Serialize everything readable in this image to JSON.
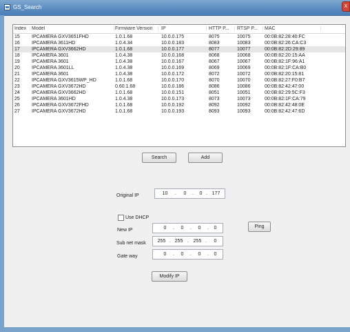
{
  "window": {
    "title": "GS_Search",
    "close_glyph": "X"
  },
  "table": {
    "columns": [
      {
        "key": "index",
        "label": "Index"
      },
      {
        "key": "model",
        "label": "Model"
      },
      {
        "key": "firmware",
        "label": "Firmware Version"
      },
      {
        "key": "ip",
        "label": "IP"
      },
      {
        "key": "http",
        "label": "HTTP P..."
      },
      {
        "key": "rtsp",
        "label": "RTSP P..."
      },
      {
        "key": "mac",
        "label": "MAC"
      }
    ],
    "selected_index": 2,
    "rows": [
      {
        "index": "15",
        "model": "IPCAMERA GXV3651FHD",
        "firmware": "1.0.1.68",
        "ip": "10.0.0.175",
        "http": "8075",
        "rtsp": "10075",
        "mac": "00:0B:82:28:40:FC"
      },
      {
        "index": "16",
        "model": "IPCAMERA 3611HD",
        "firmware": "1.0.4.34",
        "ip": "10.0.0.183",
        "http": "8083",
        "rtsp": "10083",
        "mac": "00:0B:82:26:CA:C3"
      },
      {
        "index": "17",
        "model": "IPCAMERA GXV3662HD",
        "firmware": "1.0.1.68",
        "ip": "10.0.0.177",
        "http": "8077",
        "rtsp": "10077",
        "mac": "00:0B:82:2D:29:89"
      },
      {
        "index": "18",
        "model": "IPCAMERA 3601",
        "firmware": "1.0.4.38",
        "ip": "10.0.0.168",
        "http": "8068",
        "rtsp": "10068",
        "mac": "00:0B:82:20:15:AA"
      },
      {
        "index": "19",
        "model": "IPCAMERA 3601",
        "firmware": "1.0.4.38",
        "ip": "10.0.0.167",
        "http": "8067",
        "rtsp": "10067",
        "mac": "00:0B:82:1F:96:A1"
      },
      {
        "index": "20",
        "model": "IPCAMERA 3601LL",
        "firmware": "1.0.4.38",
        "ip": "10.0.0.169",
        "http": "8069",
        "rtsp": "10069",
        "mac": "00:0B:82:1F:CA:B0"
      },
      {
        "index": "21",
        "model": "IPCAMERA 3601",
        "firmware": "1.0.4.38",
        "ip": "10.0.0.172",
        "http": "8072",
        "rtsp": "10072",
        "mac": "00:0B:82:20:15:81"
      },
      {
        "index": "22",
        "model": "IPCAMERA GXV3615WP_HD",
        "firmware": "1.0.1.68",
        "ip": "10.0.0.170",
        "http": "8070",
        "rtsp": "10070",
        "mac": "00:0B:82:27:F0:B7"
      },
      {
        "index": "23",
        "model": "IPCAMERA GXV3672HD",
        "firmware": "0.60.1.68",
        "ip": "10.0.0.186",
        "http": "8086",
        "rtsp": "10086",
        "mac": "00:0B:82:42:47:00"
      },
      {
        "index": "24",
        "model": "IPCAMERA GXV3662HD",
        "firmware": "1.0.1.68",
        "ip": "10.0.0.151",
        "http": "8051",
        "rtsp": "10051",
        "mac": "00:0B:82:29:5C:F3"
      },
      {
        "index": "25",
        "model": "IPCAMERA 3601HD",
        "firmware": "1.0.4.38",
        "ip": "10.0.0.173",
        "http": "8073",
        "rtsp": "10073",
        "mac": "00:0B:82:1F:CA:79"
      },
      {
        "index": "26",
        "model": "IPCAMERA GXV3672FHD",
        "firmware": "1.0.1.68",
        "ip": "10.0.0.192",
        "http": "8092",
        "rtsp": "10092",
        "mac": "00:0B:82:42:48:0E"
      },
      {
        "index": "27",
        "model": "IPCAMERA GXV3672HD",
        "firmware": "1.0.1.68",
        "ip": "10.0.0.193",
        "http": "8093",
        "rtsp": "10093",
        "mac": "00:0B:82:42:47:6D"
      }
    ]
  },
  "buttons": {
    "search": "Search",
    "add": "Add",
    "ping": "Ping",
    "modify_ip": "Modify IP"
  },
  "form": {
    "original_ip_label": "Original IP",
    "original_ip": [
      "10",
      "0",
      "0",
      "177"
    ],
    "use_dhcp_label": "Use DHCP",
    "use_dhcp_checked": false,
    "new_ip_label": "New IP",
    "new_ip": [
      "0",
      "0",
      "0",
      "0"
    ],
    "subnet_label": "Sub net mask",
    "subnet": [
      "255",
      "255",
      "255",
      "0"
    ],
    "gateway_label": "Gate way",
    "gateway": [
      "0",
      "0",
      "0",
      "0"
    ],
    "ip_separator": "."
  },
  "colors": {
    "title_bar": "#5d8ec2",
    "selected_row": "#e6e6e6",
    "close_button": "#d0473a"
  }
}
